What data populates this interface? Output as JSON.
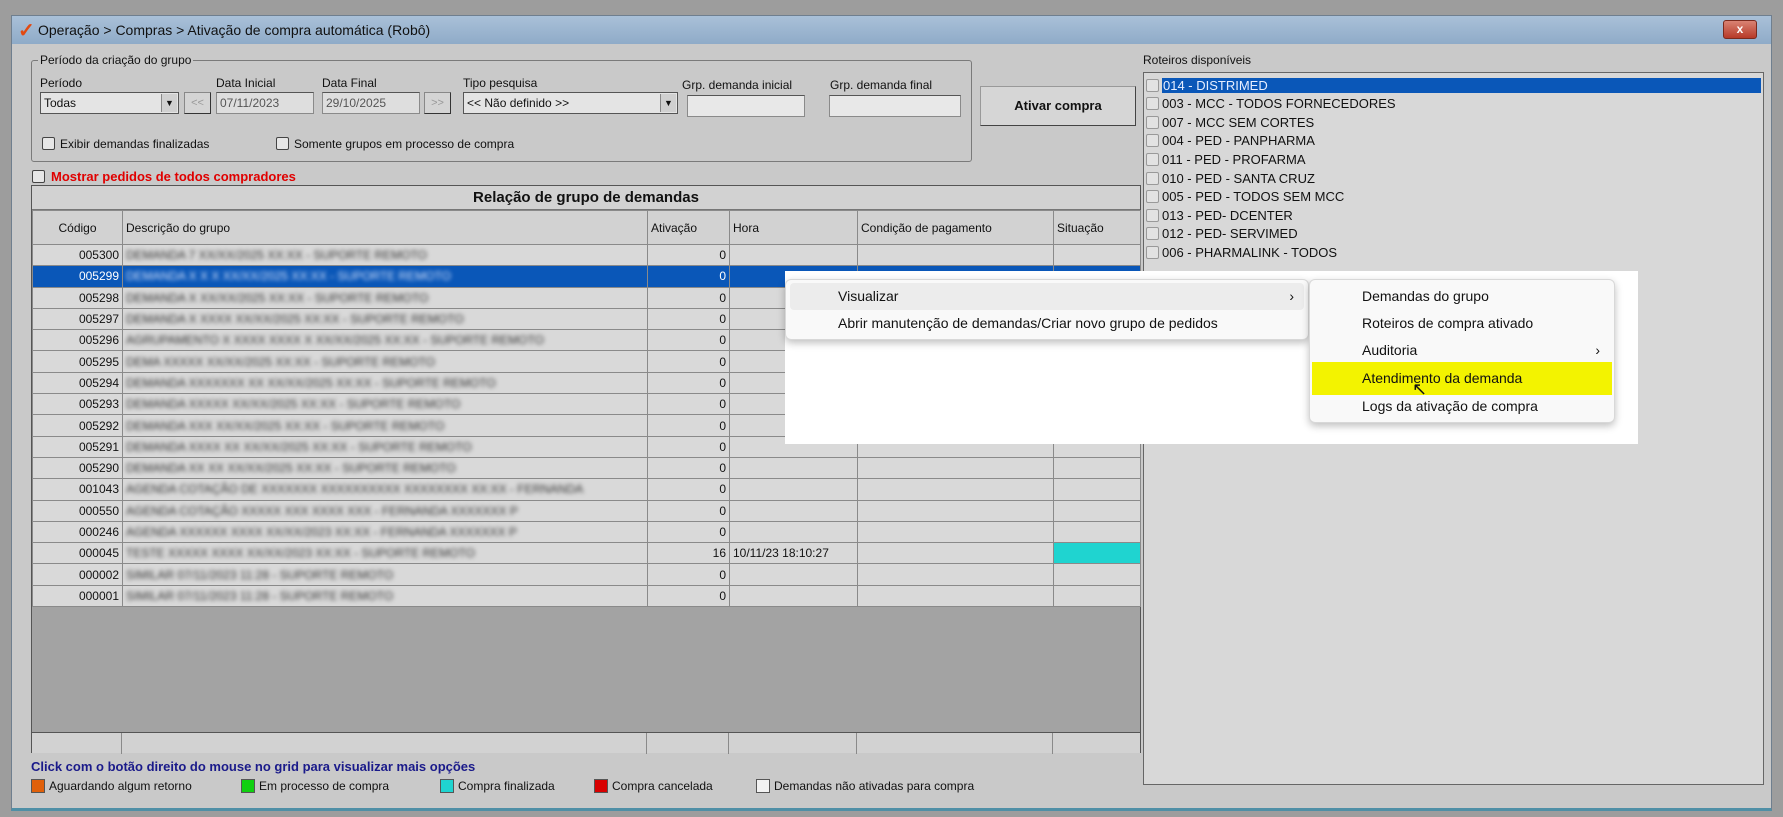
{
  "window": {
    "title": "Operação > Compras > Ativação de compra automática (Robô)",
    "close": "x"
  },
  "filters": {
    "group_label": "Período da criação do grupo",
    "periodo_label": "Período",
    "periodo_value": "Todas",
    "prev": "<<",
    "next": ">>",
    "data_inicial_label": "Data Inicial",
    "data_inicial": "07/11/2023",
    "data_final_label": "Data Final",
    "data_final": "29/10/2025",
    "tipo_label": "Tipo pesquisa",
    "tipo_value": "<< Não definido >>",
    "grp_ini_label": "Grp. demanda inicial",
    "grp_ini": "",
    "grp_fim_label": "Grp. demanda final",
    "grp_fim": "",
    "exibir": "Exibir demandas finalizadas",
    "somente": "Somente grupos em processo de compra",
    "mostrar": "Mostrar pedidos de todos compradores"
  },
  "ativar": "Ativar compra",
  "grid": {
    "title": "Relação de grupo de demandas",
    "columns": [
      "Código",
      "Descrição do grupo",
      "Ativação",
      "Hora",
      "Condição de pagamento",
      "Situação"
    ],
    "rows": [
      {
        "code": "005300",
        "desc": "DEMANDA 7 XX/XX/2025 XX:XX - SUPORTE REMOTO",
        "ativ": "0",
        "hora": ""
      },
      {
        "code": "005299",
        "desc": "DEMANDA X X X XX/XX/2025 XX:XX - SUPORTE REMOTO",
        "ativ": "0",
        "hora": ""
      },
      {
        "code": "005298",
        "desc": "DEMANDA X XX/XX/2025 XX:XX - SUPORTE REMOTO",
        "ativ": "0",
        "hora": ""
      },
      {
        "code": "005297",
        "desc": "DEMANDA X XXXX XX/XX/2025 XX:XX - SUPORTE REMOTO",
        "ativ": "0",
        "hora": ""
      },
      {
        "code": "005296",
        "desc": "AGRUPAMENTO X XXXX XXXX X XX/XX/2025 XX:XX - SUPORTE REMOTO",
        "ativ": "0",
        "hora": ""
      },
      {
        "code": "005295",
        "desc": "DEMA XXXXX XX/XX/2025 XX:XX - SUPORTE REMOTO",
        "ativ": "0",
        "hora": ""
      },
      {
        "code": "005294",
        "desc": "DEMANDA XXXXXXX XX XX/XX/2025 XX:XX - SUPORTE REMOTO",
        "ativ": "0",
        "hora": ""
      },
      {
        "code": "005293",
        "desc": "DEMANDA XXXXX XX/XX/2025 XX:XX - SUPORTE REMOTO",
        "ativ": "0",
        "hora": ""
      },
      {
        "code": "005292",
        "desc": "DEMANDA XXX XX/XX/2025 XX:XX - SUPORTE REMOTO",
        "ativ": "0",
        "hora": ""
      },
      {
        "code": "005291",
        "desc": "DEMANDA XXXX XX XX/XX/2025 XX:XX - SUPORTE REMOTO",
        "ativ": "0",
        "hora": ""
      },
      {
        "code": "005290",
        "desc": "DEMANDA XX XX XX/XX/2025 XX:XX - SUPORTE REMOTO",
        "ativ": "0",
        "hora": ""
      },
      {
        "code": "001043",
        "desc": "AGENDA COTAÇÃO DE XXXXXXX XXXXXXXXXX XXXXXXXX XX:XX - FERNANDA",
        "ativ": "0",
        "hora": ""
      },
      {
        "code": "000550",
        "desc": "AGENDA COTAÇÃO XXXXX XXX XXXX XXX - FERNANDA XXXXXXX P",
        "ativ": "0",
        "hora": ""
      },
      {
        "code": "000246",
        "desc": "AGENDA XXXXXX XXXX XX/XX/2023 XX:XX - FERNANDA XXXXXXX P",
        "ativ": "0",
        "hora": ""
      },
      {
        "code": "000045",
        "desc": "TESTE XXXXX XXXX XX/XX/2023 XX:XX - SUPORTE REMOTO",
        "ativ": "16",
        "hora": "10/11/23 18:10:27",
        "status": "finalizada"
      },
      {
        "code": "000002",
        "desc": "SIMILAR 07/11/2023 11:28 - SUPORTE REMOTO",
        "ativ": "0",
        "hora": ""
      },
      {
        "code": "000001",
        "desc": "SIMILAR 07/11/2023 11:28 - SUPORTE REMOTO",
        "ativ": "0",
        "hora": ""
      }
    ]
  },
  "hint": "Click com o botão direito do mouse no grid para visualizar mais opções",
  "legend": [
    {
      "label": "Aguardando algum retorno",
      "color": "#e0600a"
    },
    {
      "label": "Em processo de compra",
      "color": "#10d010"
    },
    {
      "label": "Compra finalizada",
      "color": "#1fd4d0"
    },
    {
      "label": "Compra cancelada",
      "color": "#d80000"
    },
    {
      "label": "Demandas não ativadas para compra",
      "color": "#f2f2f2"
    }
  ],
  "roteiros": {
    "label": "Roteiros disponíveis",
    "items": [
      "014 - DISTRIMED",
      "003 - MCC - TODOS FORNECEDORES",
      "007 - MCC SEM CORTES",
      "004 - PED - PANPHARMA",
      "011 - PED - PROFARMA",
      "010 - PED - SANTA CRUZ",
      "005 - PED - TODOS SEM MCC",
      "013 - PED- DCENTER",
      "012 - PED- SERVIMED",
      "006 - PHARMALINK - TODOS"
    ]
  },
  "context_menu": {
    "items": [
      "Visualizar",
      "Abrir manutenção de demandas/Criar novo grupo de pedidos"
    ],
    "submenu": [
      "Demandas do grupo",
      "Roteiros de compra ativado",
      "Auditoria",
      "Atendimento da demanda",
      "Logs da ativação de compra"
    ]
  }
}
